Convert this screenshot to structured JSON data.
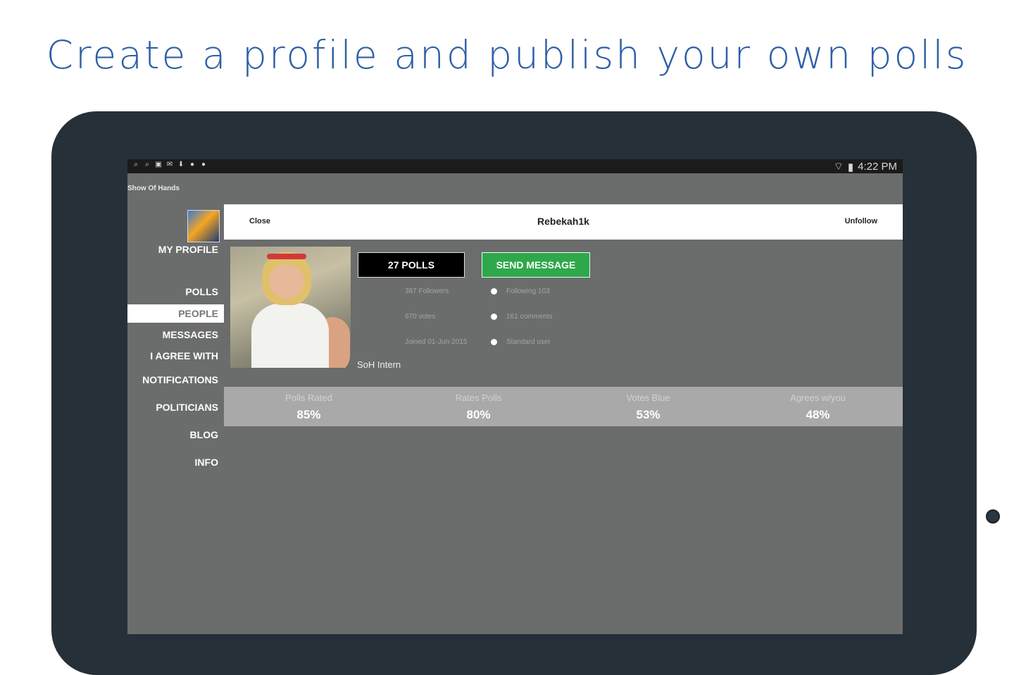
{
  "headline": "Create a profile and publish your own polls",
  "status_bar": {
    "time": "4:22 PM",
    "left_icons": [
      "voicemail-icon",
      "voicemail-icon",
      "image-icon",
      "chat-icon",
      "download-icon",
      "hangouts-icon",
      "hangouts-icon"
    ],
    "right_icons": [
      "wifi-icon",
      "battery-icon"
    ]
  },
  "app": {
    "title": "Show Of Hands"
  },
  "sidebar": {
    "profile_label": "MY PROFILE",
    "items": [
      {
        "label": "POLLS"
      },
      {
        "label": "PEOPLE",
        "active": true
      },
      {
        "label": "MESSAGES"
      },
      {
        "label": "I AGREE WITH"
      },
      {
        "label": "NOTIFICATIONS"
      },
      {
        "label": "POLITICIANS"
      },
      {
        "label": "BLOG"
      },
      {
        "label": "INFO"
      }
    ]
  },
  "profile_panel": {
    "close_label": "Close",
    "username": "Rebekah1k",
    "unfollow_label": "Unfollow",
    "polls_button": "27 POLLS",
    "send_message_button": "SEND MESSAGE",
    "stats": {
      "followers": "387 Followers",
      "following": "Following 103",
      "votes": "670 votes",
      "comments": "161 comments",
      "joined": "Joined 01-Jun-2015",
      "account_type": "Standard user"
    },
    "role": "SoH Intern",
    "ratings": [
      {
        "label": "Polls Rated",
        "value": "85%"
      },
      {
        "label": "Rates Polls",
        "value": "80%"
      },
      {
        "label": "Votes Blue",
        "value": "53%"
      },
      {
        "label": "Agrees w/you",
        "value": "48%"
      }
    ]
  },
  "colors": {
    "headline": "#2e5fa6",
    "tablet_bezel": "#263038",
    "screen_bg": "#6b6c6c",
    "send_button": "#2ea84a"
  }
}
